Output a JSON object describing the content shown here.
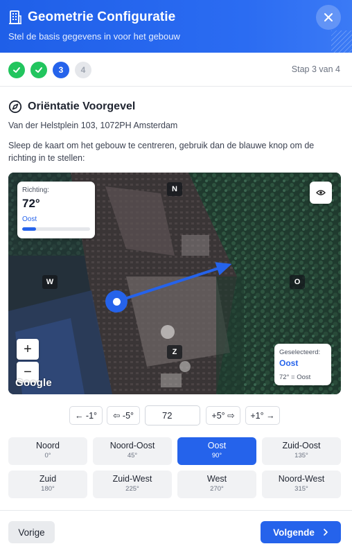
{
  "header": {
    "title": "Geometrie Configuratie",
    "subtitle": "Stel de basis gegevens in voor het gebouw",
    "close_icon": "close-icon",
    "building_icon": "building-icon"
  },
  "steps": {
    "items": [
      {
        "state": "done",
        "label": ""
      },
      {
        "state": "done",
        "label": ""
      },
      {
        "state": "active",
        "label": "3"
      },
      {
        "state": "todo",
        "label": "4"
      }
    ],
    "progress_text": "Stap 3 van 4"
  },
  "section": {
    "icon": "compass-icon",
    "title": "Oriëntatie Voorgevel",
    "address": "Van der Helstplein 103, 1072PH Amsterdam",
    "instructions": "Sleep de kaart om het gebouw te centreren, gebruik dan de blauwe knop om de richting in te stellen:"
  },
  "map": {
    "compass": {
      "north": "N",
      "west": "W",
      "east": "O",
      "south": "Z"
    },
    "direction_card": {
      "label": "Richting:",
      "value": "72°",
      "name": "Oost",
      "progress_fraction": 0.2
    },
    "selected_card": {
      "label": "Geselecteerd:",
      "name": "Oost",
      "equation": "72° = Oost"
    },
    "zoom_in": "+",
    "zoom_out": "−",
    "attribution": "Google",
    "arrow_angle_deg": 72,
    "accent_color": "#2563eb"
  },
  "adjust": {
    "minus1": "← -1°",
    "minus5": "⇦ -5°",
    "value": "72",
    "plus5": "+5° ⇨",
    "plus1": "+1° →"
  },
  "directions": [
    {
      "name": "Noord",
      "deg": "0°",
      "selected": false
    },
    {
      "name": "Noord-Oost",
      "deg": "45°",
      "selected": false
    },
    {
      "name": "Oost",
      "deg": "90°",
      "selected": true
    },
    {
      "name": "Zuid-Oost",
      "deg": "135°",
      "selected": false
    },
    {
      "name": "Zuid",
      "deg": "180°",
      "selected": false
    },
    {
      "name": "Zuid-West",
      "deg": "225°",
      "selected": false
    },
    {
      "name": "West",
      "deg": "270°",
      "selected": false
    },
    {
      "name": "Noord-West",
      "deg": "315°",
      "selected": false
    }
  ],
  "footer": {
    "prev_label": "Vorige",
    "next_label": "Volgende",
    "next_icon": "chevron-right-icon"
  }
}
